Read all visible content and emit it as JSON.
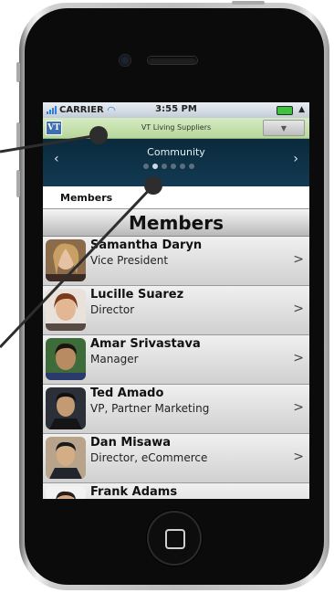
{
  "status_bar": {
    "carrier": "CARRIER",
    "time": "3:55 PM"
  },
  "app_bar": {
    "logo": "VT",
    "title": "VT Living Suppliers"
  },
  "section_nav": {
    "title": "Community",
    "prev": "‹",
    "next": "›",
    "page_count": 6,
    "active_page": 2
  },
  "tab": {
    "label": "Members"
  },
  "list_header": {
    "title": "Members"
  },
  "members": [
    {
      "name": "Samantha Daryn",
      "title": "Vice President",
      "chevron": ">"
    },
    {
      "name": "Lucille Suarez",
      "title": "Director",
      "chevron": ">"
    },
    {
      "name": "Amar Srivastava",
      "title": "Manager",
      "chevron": ">"
    },
    {
      "name": "Ted Amado",
      "title": "VP, Partner Marketing",
      "chevron": ">"
    },
    {
      "name": "Dan Misawa",
      "title": "Director, eCommerce",
      "chevron": ">"
    },
    {
      "name": "Frank Adams",
      "title": "",
      "chevron": ""
    }
  ],
  "colors": {
    "app_bar": "#c5e2ab",
    "nav": "#0f3247",
    "row": "#d8d8d8"
  },
  "icons": {
    "wifi": "wifi-icon",
    "battery": "battery-icon",
    "home": "home-button-icon"
  }
}
